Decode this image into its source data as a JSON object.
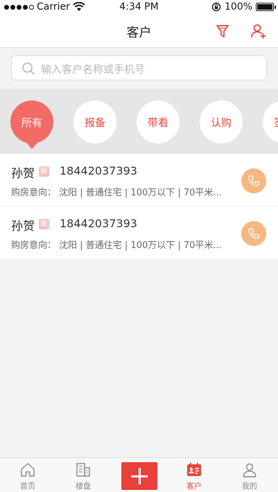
{
  "status_bar": {
    "carrier": "Carrier",
    "time": "4:34 PM",
    "battery": "100%"
  },
  "navbar": {
    "title": "客户"
  },
  "search": {
    "placeholder": "输入客户名称或手机号"
  },
  "filters": [
    {
      "label": "所有",
      "active": true
    },
    {
      "label": "报备",
      "active": false
    },
    {
      "label": "带看",
      "active": false
    },
    {
      "label": "认购",
      "active": false
    },
    {
      "label": "签",
      "active": false
    }
  ],
  "customers": [
    {
      "name": "孙贺",
      "badge": "新",
      "phone": "18442037393",
      "intent": "购房意向：  沈阳 | 普通住宅 | 100万以下 | 70平米..."
    },
    {
      "name": "孙贺",
      "badge": "新",
      "phone": "18442037393",
      "intent": "购房意向：  沈阳 | 普通住宅 | 100万以下 | 70平米..."
    }
  ],
  "tabbar": {
    "home": "首页",
    "buildings": "楼盘",
    "customers": "客户",
    "mine": "我的"
  },
  "colors": {
    "accent": "#e8473f",
    "active_pill": "#f26b67",
    "call_button": "#f8b77e"
  }
}
